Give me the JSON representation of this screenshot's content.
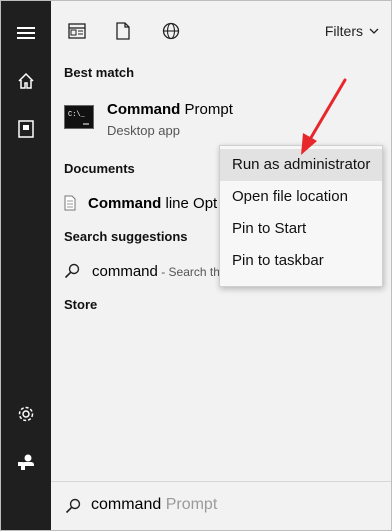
{
  "sidebar": {
    "items": [
      {
        "icon": "hamburger-icon"
      },
      {
        "icon": "home-icon"
      },
      {
        "icon": "device-icon"
      },
      {
        "icon": "gear-icon"
      },
      {
        "icon": "user-icon"
      }
    ]
  },
  "topbar": {
    "icons": [
      "apps-icon",
      "document-icon",
      "web-icon"
    ],
    "filters_label": "Filters"
  },
  "sections": {
    "best_match": "Best match",
    "documents": "Documents",
    "search_suggestions": "Search suggestions",
    "store": "Store"
  },
  "best_match": {
    "title_bold": "Command",
    "title_rest": " Prompt",
    "subtitle": "Desktop app"
  },
  "document_item": {
    "bold": "Command",
    "rest": " line Opt"
  },
  "suggestion": {
    "query": "command",
    "hint": " - Search th"
  },
  "search": {
    "typed": "command",
    "placeholder_rest": " Prompt"
  },
  "context_menu": {
    "items": [
      {
        "label": "Run as administrator"
      },
      {
        "label": "Open file location"
      },
      {
        "label": "Pin to Start"
      },
      {
        "label": "Pin to taskbar"
      }
    ]
  },
  "colors": {
    "sidebar_bg": "#1f1f1f",
    "panel_bg": "#f2f2f2",
    "arrow": "#e8272c",
    "highlight": "#e2e2e2"
  }
}
